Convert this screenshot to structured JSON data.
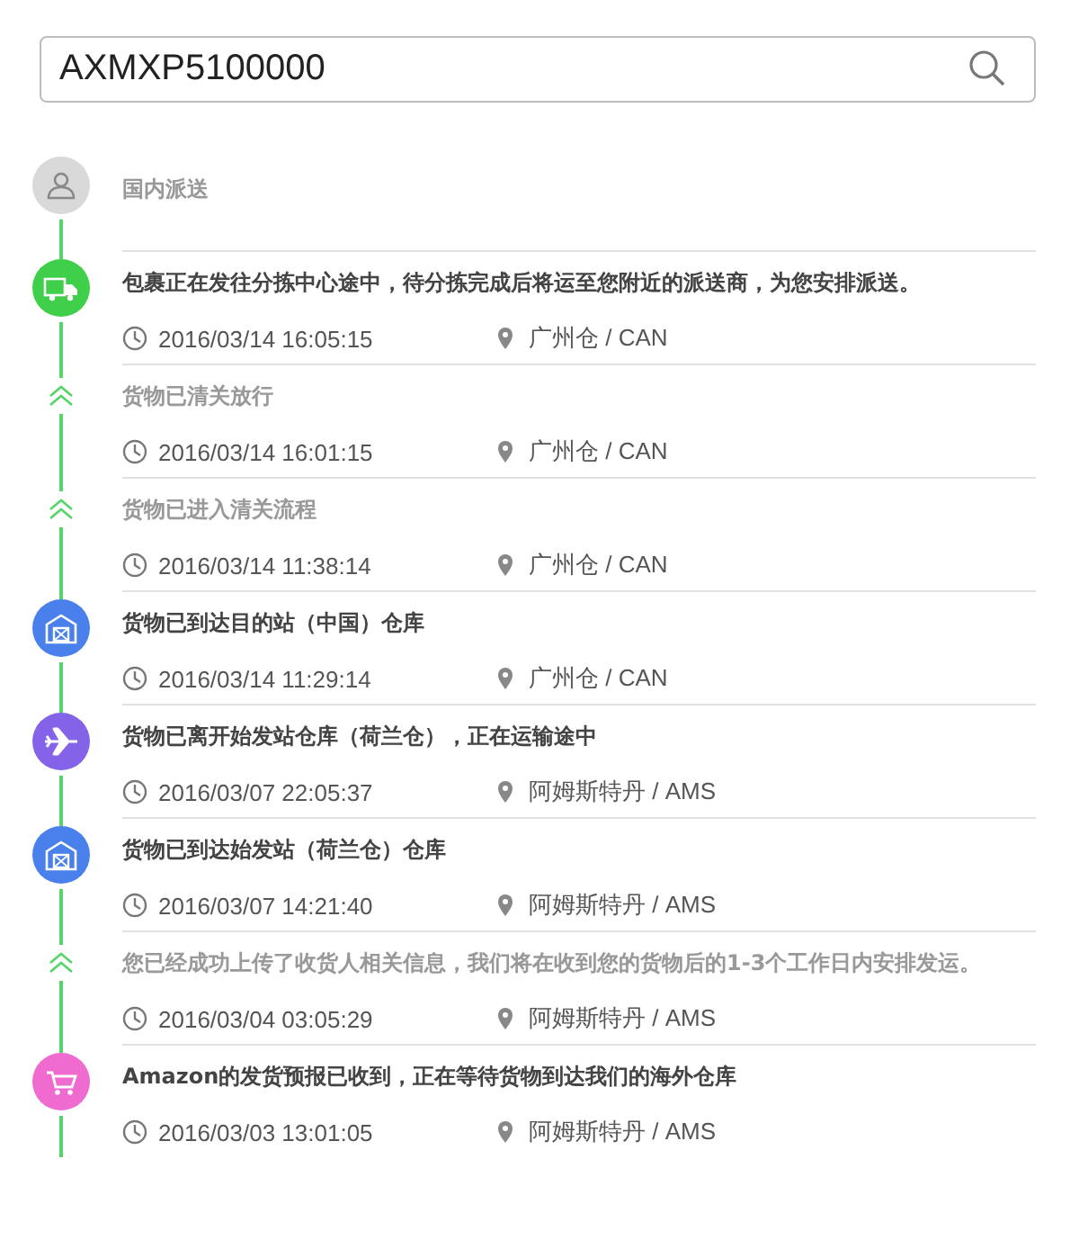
{
  "search": {
    "value": "AXMXP5100000"
  },
  "events": [
    {
      "kind": "person",
      "color": "#d9d9d9",
      "title": "国内派送"
    },
    {
      "kind": "truck",
      "color": "#3fcf4a",
      "title": "包裹正在发往分拣中心途中，待分拣完成后将运至您附近的派送商，为您安排派送。",
      "time": "2016/03/14 16:05:15",
      "place": "广州仓 / CAN"
    },
    {
      "kind": "step",
      "title": "货物已清关放行",
      "time": "2016/03/14 16:01:15",
      "place": "广州仓 / CAN"
    },
    {
      "kind": "step",
      "title": "货物已进入清关流程",
      "time": "2016/03/14 11:38:14",
      "place": "广州仓 / CAN"
    },
    {
      "kind": "warehouse",
      "color": "#4a80ec",
      "title": "货物已到达目的站（中国）仓库",
      "time": "2016/03/14 11:29:14",
      "place": "广州仓 / CAN"
    },
    {
      "kind": "plane",
      "color": "#8563e8",
      "title": "货物已离开始发站仓库（荷兰仓），正在运输途中",
      "time": "2016/03/07 22:05:37",
      "place": "阿姆斯特丹 / AMS"
    },
    {
      "kind": "warehouse",
      "color": "#4a80ec",
      "title": "货物已到达始发站（荷兰仓）仓库",
      "time": "2016/03/07 14:21:40",
      "place": "阿姆斯特丹 / AMS"
    },
    {
      "kind": "step",
      "title": "您已经成功上传了收货人相关信息，我们将在收到您的货物后的1-3个工作日内安排发运。",
      "time": "2016/03/04 03:05:29",
      "place": "阿姆斯特丹 / AMS"
    },
    {
      "kind": "cart",
      "color": "#f06bd0",
      "title": "Amazon的发货预报已收到，正在等待货物到达我们的海外仓库",
      "time": "2016/03/03 13:01:05",
      "place": "阿姆斯特丹 / AMS"
    }
  ]
}
